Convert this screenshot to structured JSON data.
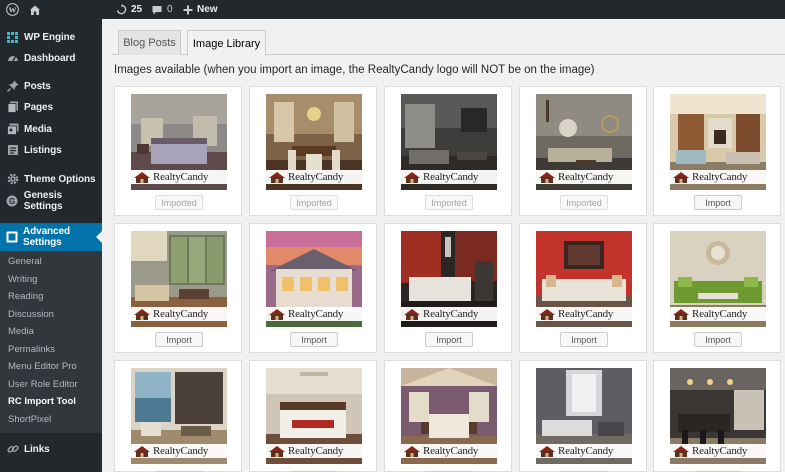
{
  "adminbar": {
    "updates_count": "25",
    "comments_count": "0",
    "new_label": "New"
  },
  "sidebar": {
    "items": [
      {
        "label": "WP Engine",
        "icon": "wp-engine-icon"
      },
      {
        "label": "Dashboard",
        "icon": "dashboard-icon"
      },
      {
        "label": "Posts",
        "icon": "pin-icon"
      },
      {
        "label": "Pages",
        "icon": "pages-icon"
      },
      {
        "label": "Media",
        "icon": "media-icon"
      },
      {
        "label": "Listings",
        "icon": "listings-icon"
      },
      {
        "label": "Theme Options",
        "icon": "gear-icon"
      },
      {
        "label": "Genesis Settings",
        "icon": "genesis-icon"
      },
      {
        "label": "Advanced Settings",
        "icon": "advanced-settings-icon"
      },
      {
        "label": "Links",
        "icon": "link-icon"
      }
    ],
    "submenu": [
      "General",
      "Writing",
      "Reading",
      "Discussion",
      "Media",
      "Permalinks",
      "Menu Editor Pro",
      "User Role Editor",
      "RC Import Tool",
      "ShortPixel"
    ],
    "current_submenu": "RC Import Tool"
  },
  "tabs": [
    {
      "label": "Blog Posts",
      "active": false
    },
    {
      "label": "Image Library",
      "active": true
    }
  ],
  "heading": "Images available (when you import an image, the RealtyCandy logo will NOT be on the image)",
  "logo_text": "RealtyCandy",
  "images": [
    {
      "button": "Imported",
      "imported": true,
      "scene": "bedroom"
    },
    {
      "button": "Imported",
      "imported": true,
      "scene": "dining-room"
    },
    {
      "button": "Imported",
      "imported": true,
      "scene": "dark-room"
    },
    {
      "button": "Imported",
      "imported": true,
      "scene": "living-room"
    },
    {
      "button": "Import",
      "imported": false,
      "scene": "living-room-fireplace"
    },
    {
      "button": "Import",
      "imported": false,
      "scene": "windows-room"
    },
    {
      "button": "Import",
      "imported": false,
      "scene": "house-exterior-sunset"
    },
    {
      "button": "Import",
      "imported": false,
      "scene": "red-kitchen"
    },
    {
      "button": "Import",
      "imported": false,
      "scene": "red-living-room"
    },
    {
      "button": "Import",
      "imported": false,
      "scene": "green-sofa-mirror"
    },
    {
      "button": "Import",
      "imported": false,
      "scene": "ocean-view-room"
    },
    {
      "button": "Import",
      "imported": false,
      "scene": "white-bedroom"
    },
    {
      "button": "Import",
      "imported": false,
      "scene": "purple-bedroom"
    },
    {
      "button": "Import",
      "imported": false,
      "scene": "gray-lounge"
    },
    {
      "button": "Import",
      "imported": false,
      "scene": "dark-kitchen"
    }
  ],
  "colors": {
    "adminbar": "#23282d",
    "sidebar": "#23282d",
    "submenu": "#32373c",
    "accent": "#0073aa"
  }
}
